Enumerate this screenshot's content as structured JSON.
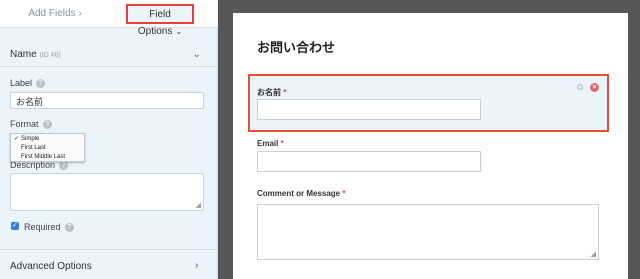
{
  "tabs": {
    "add_fields": "Add Fields",
    "add_fields_chevron": "›",
    "field_options": "Field Options",
    "field_options_chevron": "⌄"
  },
  "field_options": {
    "section_title": "Name",
    "section_id": "(ID #0)",
    "section_chevron": "⌄",
    "label_title": "Label",
    "label_value": "お名前",
    "format_title": "Format",
    "format_options": [
      "Simple",
      "First Last",
      "First Middle Last"
    ],
    "format_selected": "Simple",
    "description_title": "Description",
    "description_value": "",
    "required_label": "Required",
    "required_checked": "✓",
    "advanced_options": "Advanced Options",
    "advanced_chevron": "›",
    "help_glyph": "?"
  },
  "form": {
    "title": "お問い合わせ",
    "required_marker": "*",
    "fields": [
      {
        "label": "お名前",
        "value": ""
      },
      {
        "label": "Email",
        "value": ""
      },
      {
        "label": "Comment or Message",
        "value": ""
      }
    ],
    "duplicate_glyph": "⧉",
    "delete_glyph": "×"
  },
  "colors": {
    "accent_red": "#e53f3f",
    "panel_bg": "#ebf3fb",
    "canvas_bg": "#575757",
    "checkbox_blue": "#2f82d6"
  }
}
